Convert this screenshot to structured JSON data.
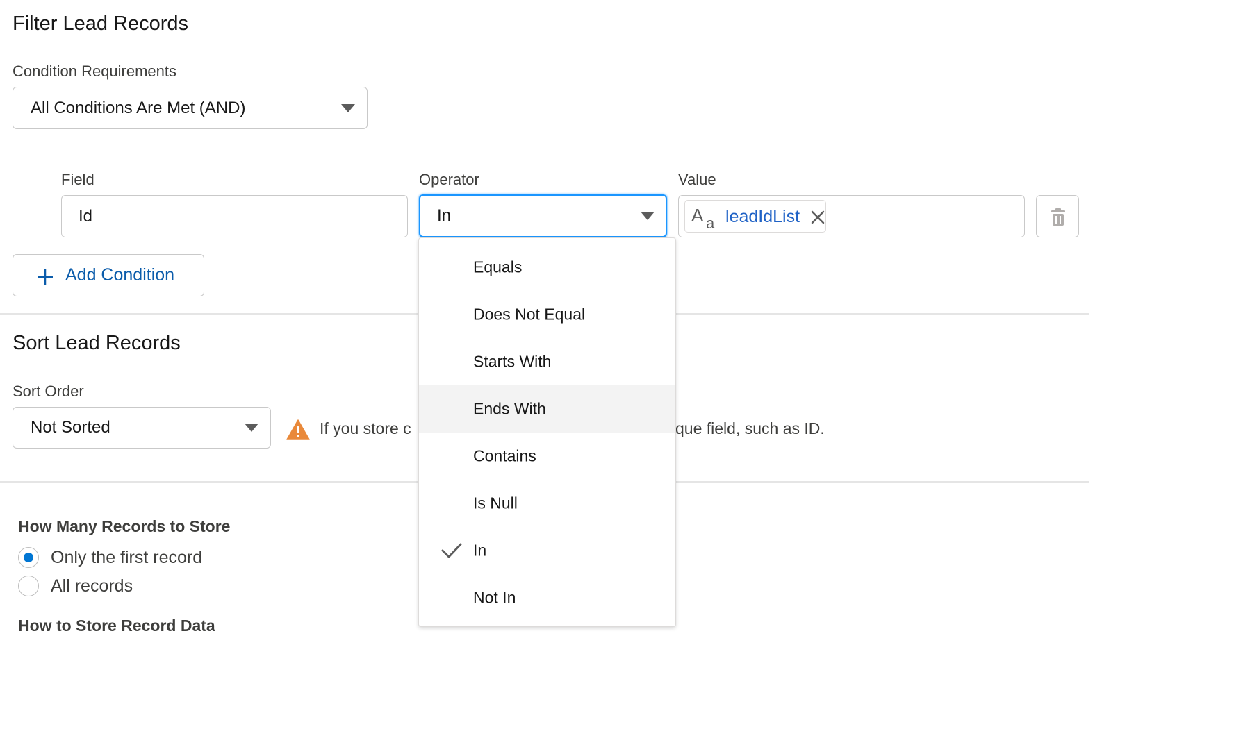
{
  "filter": {
    "title": "Filter Lead Records",
    "condition_label": "Condition Requirements",
    "condition_value": "All Conditions Are Met (AND)",
    "field_label": "Field",
    "operator_label": "Operator",
    "value_label": "Value",
    "field_value": "Id",
    "operator_value": "In",
    "value_pill": "leadIdList",
    "add_condition": "Add Condition"
  },
  "operator_menu": {
    "options": [
      "Equals",
      "Does Not Equal",
      "Starts With",
      "Ends With",
      "Contains",
      "Is Null",
      "In",
      "Not In"
    ],
    "hovered": "Ends With",
    "selected": "In"
  },
  "sort": {
    "title": "Sort Lead Records",
    "order_label": "Sort Order",
    "order_value": "Not Sorted",
    "warning_left": "If you store c",
    "warning_right": "que field, such as ID."
  },
  "store": {
    "how_many_label": "How Many Records to Store",
    "options": [
      "Only the first record",
      "All records"
    ],
    "selected": "Only the first record",
    "how_to_label": "How to Store Record Data"
  },
  "colors": {
    "link_blue": "#0b5cab",
    "focus_blue": "#1b96ff",
    "radio_blue": "#0176d3",
    "warning_orange": "#e9893a"
  }
}
